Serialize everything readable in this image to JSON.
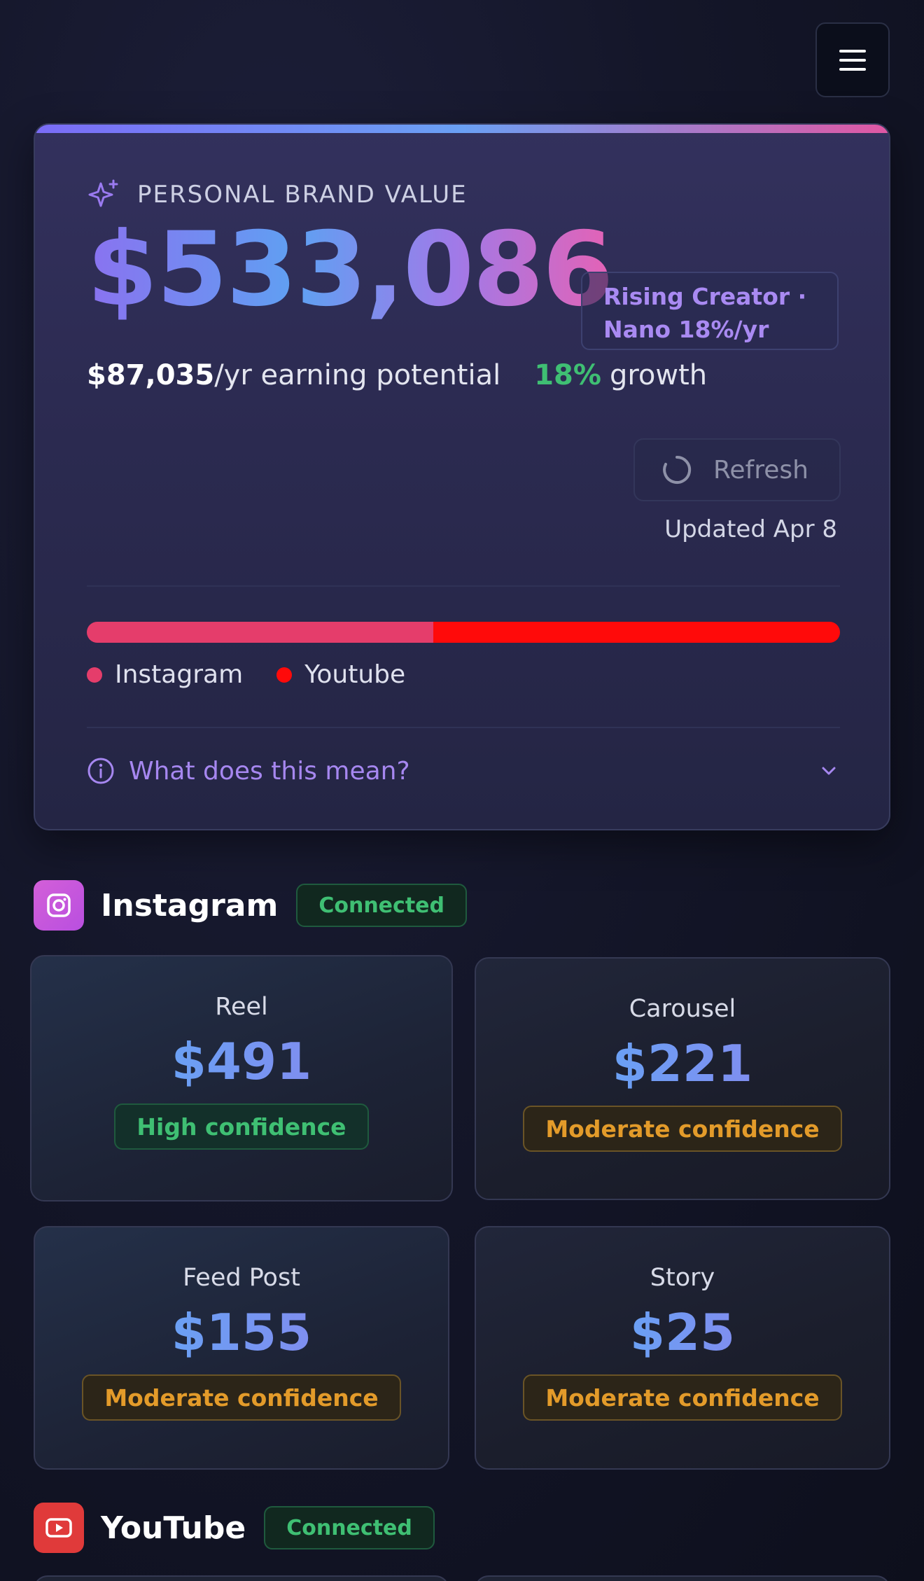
{
  "menu": {
    "icon": "hamburger-icon"
  },
  "brand": {
    "label": "PERSONAL BRAND VALUE",
    "value": "$533,086",
    "tier_line1": "Rising Creator ·",
    "tier_line2": "Nano 18%/yr",
    "earning_amount": "$87,035",
    "earning_suffix": "/yr earning potential",
    "growth_pct": "18%",
    "growth_label": "growth",
    "refresh_label": "Refresh",
    "updated": "Updated Apr 8",
    "split": [
      {
        "name": "Instagram",
        "share": 0.46,
        "color": "#e53d6b"
      },
      {
        "name": "Youtube",
        "share": 0.54,
        "color": "#ff0a0a"
      }
    ],
    "explain_label": "What does this mean?"
  },
  "instagram": {
    "name": "Instagram",
    "status": "Connected",
    "rates": [
      {
        "type": "Reel",
        "price": "$491",
        "confidence": "High confidence"
      },
      {
        "type": "Carousel",
        "price": "$221",
        "confidence": "Moderate confidence"
      },
      {
        "type": "Feed Post",
        "price": "$155",
        "confidence": "Moderate confidence"
      },
      {
        "type": "Story",
        "price": "$25",
        "confidence": "Moderate confidence"
      }
    ]
  },
  "youtube": {
    "name": "YouTube",
    "status": "Connected"
  },
  "colors": {
    "accent_purple": "#a687f0",
    "growth_green": "#3fbf73",
    "moderate_amber": "#e39b2a",
    "instagram_pink": "#e53d6b",
    "youtube_red": "#ff0a0a"
  }
}
